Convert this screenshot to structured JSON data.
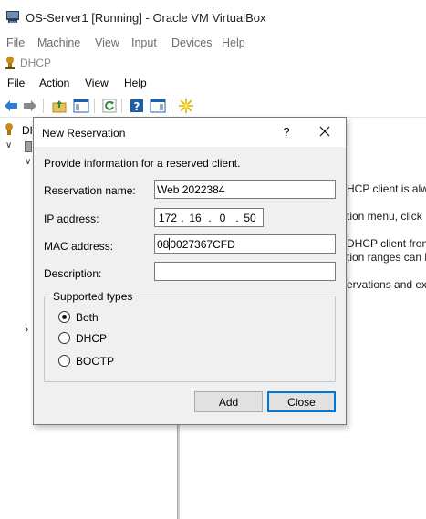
{
  "vbox": {
    "title": "OS-Server1 [Running] - Oracle VM VirtualBox",
    "menu": [
      "File",
      "Machine",
      "View",
      "Input",
      "Devices",
      "Help"
    ]
  },
  "dhcp": {
    "title": "DHCP",
    "menu": [
      "File",
      "Action",
      "View",
      "Help"
    ],
    "tree_root": "DH",
    "background_lines": [
      "HCP client is alwa",
      "tion menu, click",
      "DHCP client from",
      "tion ranges can b",
      "ervations and ex"
    ]
  },
  "dialog": {
    "title": "New Reservation",
    "help_glyph": "?",
    "intro": "Provide information for a reserved client.",
    "reservation_name_label": "Reservation name:",
    "reservation_name_value": "Web 2022384",
    "ip_label": "IP address:",
    "ip_octets": [
      "172",
      "16",
      "0",
      "50"
    ],
    "mac_label": "MAC address:",
    "mac_value_before_caret": "08",
    "mac_value_after_caret": "0027367CFD",
    "description_label": "Description:",
    "description_value": "",
    "group_label": "Supported types",
    "types": [
      {
        "label": "Both",
        "checked": true
      },
      {
        "label": "DHCP",
        "checked": false
      },
      {
        "label": "BOOTP",
        "checked": false
      }
    ],
    "add_label": "Add",
    "close_label": "Close"
  },
  "colors": {
    "accent": "#0078d7",
    "dialog_bg": "#f0f0f0",
    "muted_menu": "#6d6d6d"
  }
}
